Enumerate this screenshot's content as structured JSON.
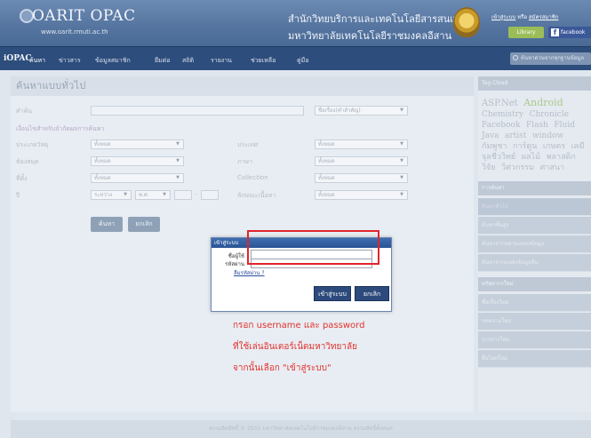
{
  "header": {
    "logo": "OARIT OPAC",
    "logo_url": "www.oarit.rmuti.ac.th",
    "institution_line1": "สำนักวิทยบริการและเทคโนโลยีสารสนเทศ",
    "institution_line2": "มหาวิทยาลัยเทคโนโลยีราชมงคลอีสาน",
    "top_link_login": "เข้าสู่ระบบ",
    "top_link_or": "หรือ",
    "top_link_register": "สมัครสมาชิก",
    "library_button": "Library",
    "facebook_button": "facebook"
  },
  "nav": {
    "brand": "iOPAC",
    "items": [
      "ค้นหา",
      "ข่าวสาร",
      "ข้อมูลสมาชิก",
      "ยืมต่อ",
      "สถิติ",
      "รายงาน",
      "ช่วยเหลือ",
      "คู่มือ"
    ],
    "search_placeholder": "ค้นหาด่วนจากทุกฐานข้อมูล"
  },
  "search": {
    "title": "ค้นหาแบบทั่วไป",
    "keyword_label": "คำค้น",
    "keyword_type": "ชื่อเรื่อง(คำสำคัญ)",
    "options_link": "เงื่อนไขสำหรับจำกัดผลการค้นหา",
    "material_label": "ประเภทวัสดุ",
    "material_value": "ทั้งหมด",
    "country_label": "ประเทศ",
    "country_value": "ทั้งหมด",
    "library_label": "ห้องสมุด",
    "library_value": "ทั้งหมด",
    "language_label": "ภาษา",
    "language_value": "ทั้งหมด",
    "location_label": "ที่ตั้ง",
    "location_value": "ทั้งหมด",
    "collection_label": "Collection",
    "collection_value": "ทั้งหมด",
    "year_label": "ปี",
    "year_range": "ระหว่าง",
    "year_era": "พ.ศ.",
    "year_dash": "-",
    "media_label": "ลักษณะเนื้อหา",
    "media_value": "ทั้งหมด",
    "search_button": "ค้นหา",
    "cancel_button": "ยกเลิก"
  },
  "login_dialog": {
    "title": "เข้าสู่ระบบ",
    "username_label": "ชื่อผู้ใช้",
    "password_label": "รหัสผ่าน",
    "forgot_link": "ลืมรหัสผ่าน ?",
    "login_button": "เข้าสู่ระบบ",
    "cancel_button": "ยกเลิก"
  },
  "instruction": {
    "line1": "กรอก username และ password",
    "line2": "ที่ใช้เล่นอินเตอร์เน็ตมหาวิทยาลัย",
    "line3": "จากนั้นเลือก \"เข้าสู่ระบบ\""
  },
  "sidebar": {
    "tagcloud_title": "Tag Cloud",
    "tags": [
      "ASP.Net",
      "Android",
      "Chemistry",
      "Chronicle",
      "Facebook",
      "Flash",
      "Fluid",
      "Java",
      "artist",
      "window",
      "กัมพูชา",
      "การ์ตูน",
      "เกษตร",
      "เคมี",
      "จุลชีววิทย์",
      "ผลไม้",
      "พลาสติก",
      "วิจัย",
      "วิศวกรรม",
      "ศาสนา"
    ],
    "search_title": "การค้นหา",
    "search_items": [
      "ค้นหาทั่วไป",
      "ค้นหาขั้นสูง",
      "ค้นหาจากหลายแหล่งข้อมูล",
      "ค้นหาจากแหล่งข้อมูลอื่น"
    ],
    "new_title": "ทรัพยากรใหม่",
    "new_items": [
      "ชื่อเรื่องใหม่",
      "บทความใหม่",
      "วารสารใหม่",
      "สื่อโสตใหม่"
    ]
  },
  "footer": {
    "copyright": "สงวนลิขสิทธิ์ © 2555 มหาวิทยาลัยเทคโนโลยีราชมงคลอีสาน สงวนสิทธิ์ทั้งหมด"
  },
  "colors": {
    "nav": "#2d4d7c",
    "header": "#5676a1",
    "highlight": "#e0252b",
    "dialog_title": "#2a5595"
  }
}
